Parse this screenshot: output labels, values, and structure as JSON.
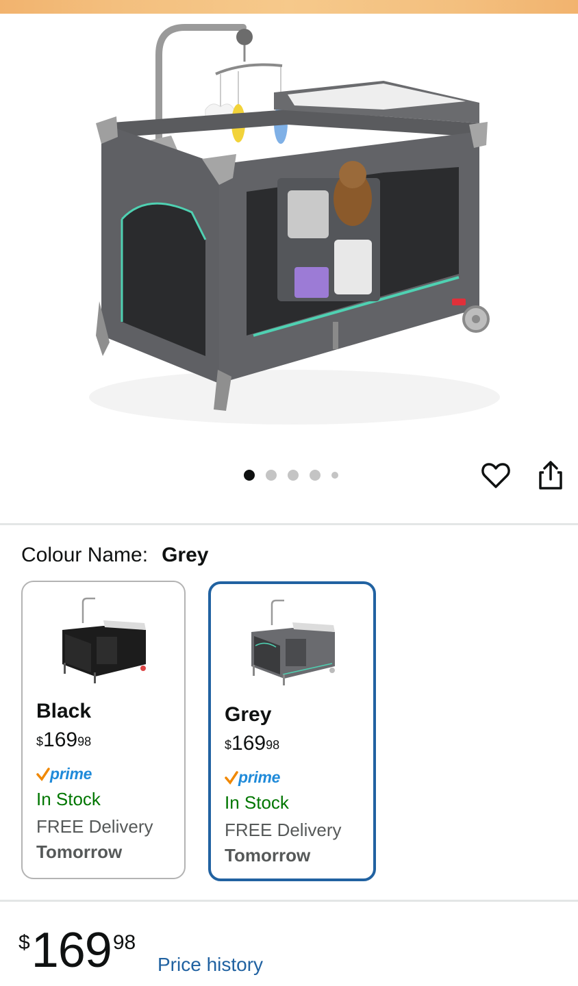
{
  "pager": {
    "count": 5,
    "active": 1
  },
  "icons": {
    "favorite": "heart-icon",
    "share": "share-icon"
  },
  "colour": {
    "label": "Colour Name:",
    "value": "Grey"
  },
  "swatches": [
    {
      "name": "Black",
      "price_currency": "$",
      "price_whole": "169",
      "price_fraction": "98",
      "prime": "prime",
      "stock": "In Stock",
      "delivery": "FREE Delivery",
      "delivery_day": "Tomorrow"
    },
    {
      "name": "Grey",
      "price_currency": "$",
      "price_whole": "169",
      "price_fraction": "98",
      "prime": "prime",
      "stock": "In Stock",
      "delivery": "FREE Delivery",
      "delivery_day": "Tomorrow"
    }
  ],
  "price": {
    "currency": "$",
    "whole": "169",
    "fraction": "98",
    "history_link": "Price history"
  },
  "colors": {
    "link": "#2162a1",
    "stock": "#007600",
    "selected_border": "#2162a1",
    "prime": "#1f8ad9"
  }
}
